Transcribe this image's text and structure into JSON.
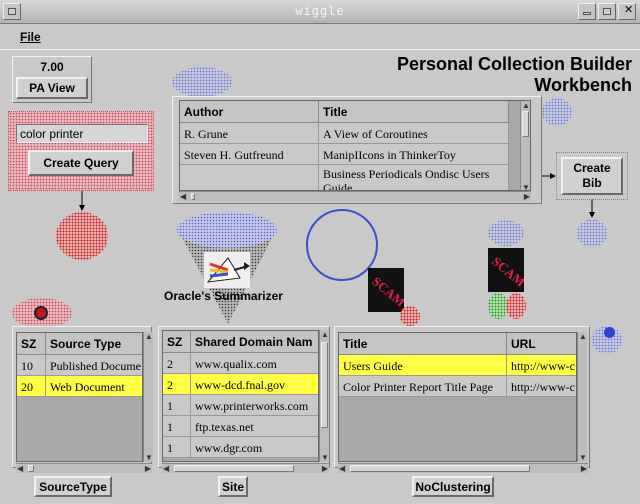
{
  "window": {
    "title": "wiggle"
  },
  "menu": {
    "file_label": "File"
  },
  "pa_panel": {
    "value": "7.00",
    "button_label": "PA View"
  },
  "heading": {
    "line1": "Personal Collection Builder",
    "line2": "Workbench"
  },
  "query": {
    "input_value": "color printer",
    "button_label": "Create Query"
  },
  "create_bib_label": "Create Bib",
  "summarizer_label": "Oracle's Summarizer",
  "scam_label": "SCAM",
  "bib_table": {
    "headers": [
      "Author",
      "Title"
    ],
    "rows": [
      {
        "author": "R. Grune",
        "title": "A View of Coroutines"
      },
      {
        "author": "Steven H. Gutfreund",
        "title": "ManipIIcons in ThinkerToy"
      },
      {
        "author": "",
        "title": "Business Periodicals Ondisc Users Guide"
      }
    ]
  },
  "source_table": {
    "headers": [
      "SZ",
      "Source Type"
    ],
    "rows": [
      {
        "sz": "10",
        "type": "Published Docume",
        "selected": false
      },
      {
        "sz": "20",
        "type": "Web Document",
        "selected": true
      }
    ]
  },
  "domain_table": {
    "headers": [
      "SZ",
      "Shared Domain Nam"
    ],
    "rows": [
      {
        "sz": "2",
        "domain": "www.qualix.com",
        "selected": false
      },
      {
        "sz": "2",
        "domain": "www-dcd.fnal.gov",
        "selected": true
      },
      {
        "sz": "1",
        "domain": "www.printerworks.com",
        "selected": false
      },
      {
        "sz": "1",
        "domain": "ftp.texas.net",
        "selected": false
      },
      {
        "sz": "1",
        "domain": "www.dgr.com",
        "selected": false
      }
    ]
  },
  "doc_table": {
    "headers": [
      "Title",
      "URL"
    ],
    "rows": [
      {
        "title": "Users Guide",
        "url": "http://www-c",
        "selected": true
      },
      {
        "title": "Color Printer Report Title Page",
        "url": "http://www-c",
        "selected": false
      }
    ]
  },
  "bottom_buttons": {
    "source_type": "SourceType",
    "site": "Site",
    "clustering": "NoClustering"
  },
  "colors": {
    "selection": "#ffff44",
    "background": "#c9c9c9",
    "pink_dots": "#d02020",
    "blue_dots": "#5560c0"
  }
}
